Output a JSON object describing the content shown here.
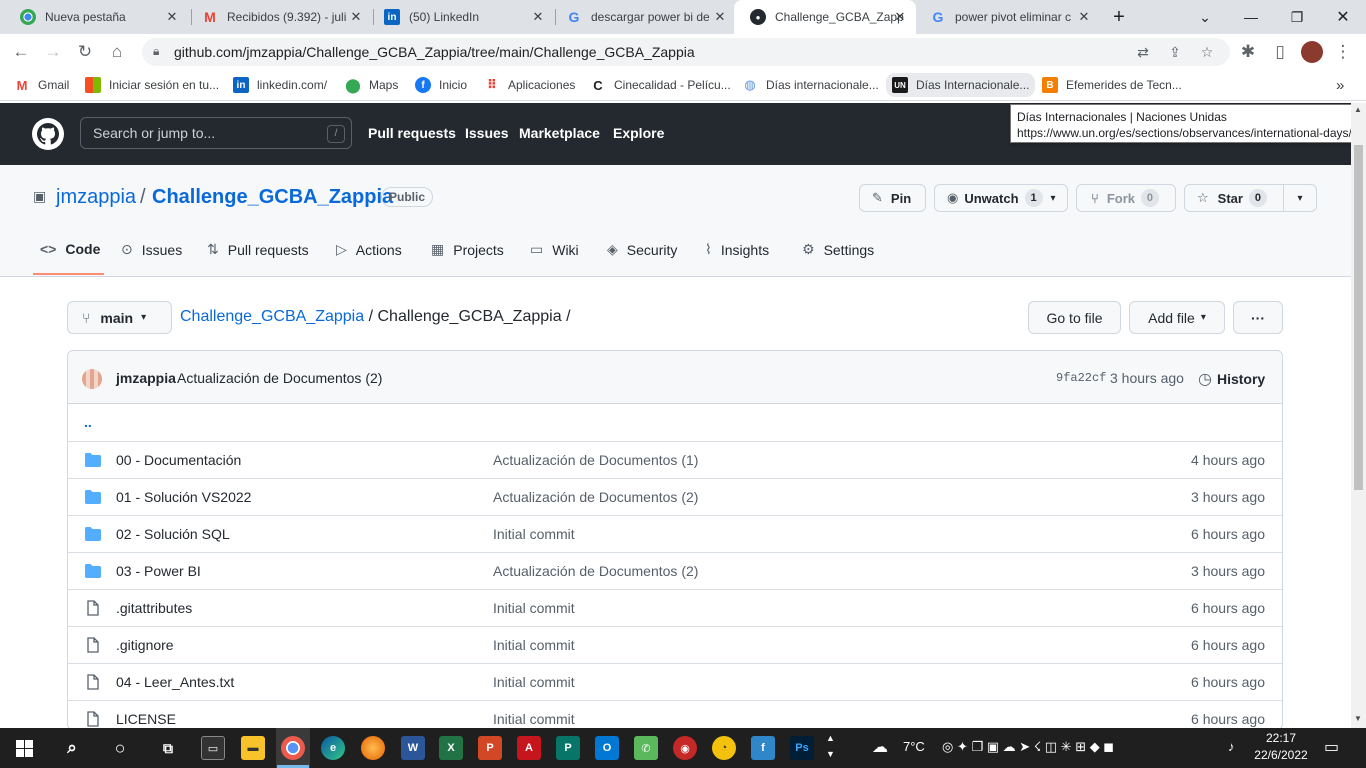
{
  "browser": {
    "tabs": [
      {
        "title": "Nueva pestaña",
        "icon": "chrome-icon"
      },
      {
        "title": "Recibidos (9.392) - juli",
        "icon": "gmail-icon"
      },
      {
        "title": "(50) LinkedIn",
        "icon": "linkedin-icon"
      },
      {
        "title": "descargar power bi de",
        "icon": "google-icon"
      },
      {
        "title": "Challenge_GCBA_Zapp",
        "icon": "github-icon",
        "active": true
      },
      {
        "title": "power pivot eliminar c",
        "icon": "google-icon"
      }
    ],
    "url": "github.com/jmzappia/Challenge_GCBA_Zappia/tree/main/Challenge_GCBA_Zappia",
    "bookmarks": [
      {
        "label": "Gmail",
        "icon": "gmail-icon"
      },
      {
        "label": "Iniciar sesión en tu...",
        "icon": "microsoft-icon"
      },
      {
        "label": "linkedin.com/",
        "icon": "linkedin-icon"
      },
      {
        "label": "Maps",
        "icon": "maps-icon"
      },
      {
        "label": "Inicio",
        "icon": "facebook-icon"
      },
      {
        "label": "Aplicaciones",
        "icon": "apps-grid-icon"
      },
      {
        "label": "Cinecalidad - Pelícu...",
        "icon": "cinecalidad-icon"
      },
      {
        "label": "Días internacionale...",
        "icon": "un-globe-icon"
      },
      {
        "label": "Días Internacionale...",
        "icon": "un-icon"
      },
      {
        "label": "Efemerides de Tecn...",
        "icon": "blogger-icon"
      }
    ],
    "tooltip": {
      "title": "Días Internacionales | Naciones Unidas",
      "url": "https://www.un.org/es/sections/observances/international-days/"
    }
  },
  "github": {
    "search_placeholder": "Search or jump to...",
    "search_shortcut": "/",
    "nav": [
      "Pull requests",
      "Issues",
      "Marketplace",
      "Explore"
    ]
  },
  "repo": {
    "owner": "jmzappia",
    "name": "Challenge_GCBA_Zappia",
    "visibility": "Public",
    "pin_label": "Pin",
    "watch_label": "Unwatch",
    "watch_count": "1",
    "fork_label": "Fork",
    "fork_count": "0",
    "star_label": "Star",
    "star_count": "0",
    "tabs": [
      "Code",
      "Issues",
      "Pull requests",
      "Actions",
      "Projects",
      "Wiki",
      "Security",
      "Insights",
      "Settings"
    ],
    "active_tab": "Code"
  },
  "browser_path": {
    "branch": "main",
    "root_link": "Challenge_GCBA_Zappia",
    "current_folder": "Challenge_GCBA_Zappia",
    "separator": "/",
    "go_to_file": "Go to file",
    "add_file": "Add file",
    "more": "···"
  },
  "commit": {
    "author": "jmzappia",
    "message": "Actualización de Documentos (2)",
    "sha": "9fa22cf",
    "time": "3 hours ago",
    "history_label": "History"
  },
  "parent_dir": "..",
  "files": [
    {
      "type": "folder",
      "name": "00 - Documentación",
      "message": "Actualización de Documentos (1)",
      "age": "4 hours ago"
    },
    {
      "type": "folder",
      "name": "01 - Solución VS2022",
      "message": "Actualización de Documentos (2)",
      "age": "3 hours ago"
    },
    {
      "type": "folder",
      "name": "02 - Solución SQL",
      "message": "Initial commit",
      "age": "6 hours ago"
    },
    {
      "type": "folder",
      "name": "03 - Power BI",
      "message": "Actualización de Documentos (2)",
      "age": "3 hours ago"
    },
    {
      "type": "file",
      "name": ".gitattributes",
      "message": "Initial commit",
      "age": "6 hours ago"
    },
    {
      "type": "file",
      "name": ".gitignore",
      "message": "Initial commit",
      "age": "6 hours ago"
    },
    {
      "type": "file",
      "name": "04 - Leer_Antes.txt",
      "message": "Initial commit",
      "age": "6 hours ago"
    },
    {
      "type": "file",
      "name": "LICENSE",
      "message": "Initial commit",
      "age": "6 hours ago"
    }
  ],
  "taskbar": {
    "weather": "7°C",
    "time": "22:17",
    "date": "22/6/2022"
  },
  "colors": {
    "github_header": "#24292f",
    "link_blue": "#0969da",
    "folder_blue": "#54aeff",
    "active_tab_underline": "#fd8c73",
    "taskbar": "#1f1f1f"
  }
}
